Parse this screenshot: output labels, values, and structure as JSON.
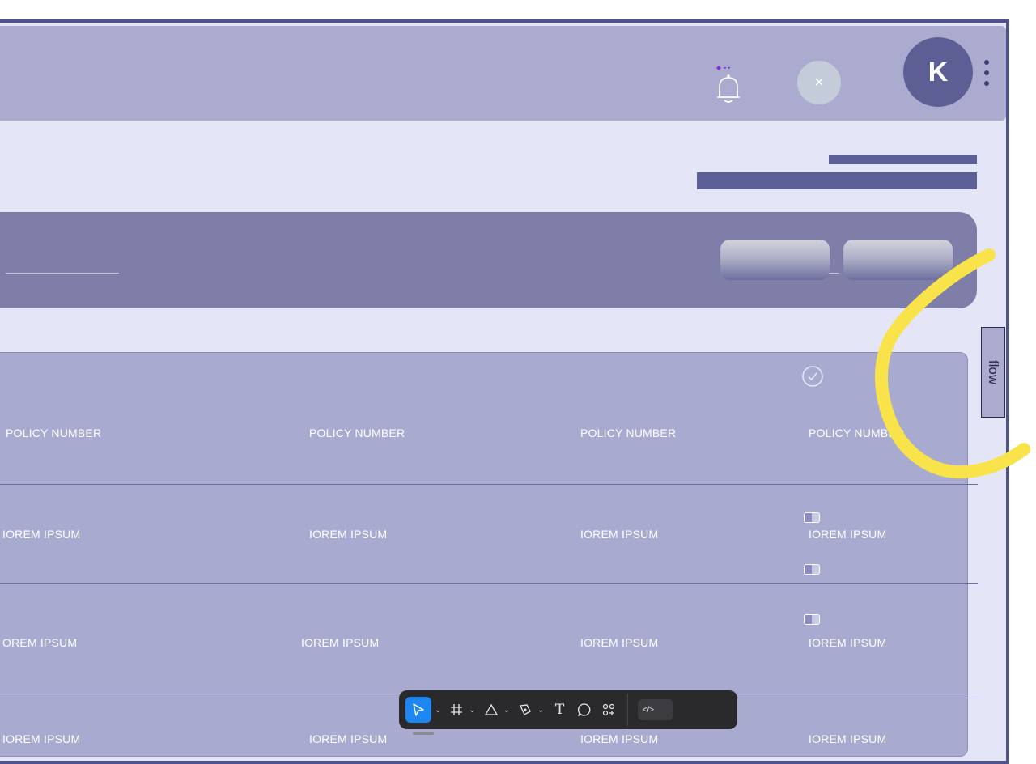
{
  "header": {
    "avatar_letter": "K",
    "close_symbol": "×"
  },
  "table": {
    "header_row": [
      "POLICY NUMBER",
      "POLICY NUMBER",
      "POLICY NUMBER",
      "POLICY NUMBER"
    ],
    "rows": [
      [
        "IOREM IPSUM",
        "IOREM IPSUM",
        "IOREM IPSUM",
        "IOREM IPSUM"
      ],
      [
        "OREM IPSUM",
        "IOREM IPSUM",
        "IOREM IPSUM",
        "IOREM IPSUM"
      ],
      [
        "IOREM IPSUM",
        "IOREM IPSUM",
        "IOREM IPSUM",
        "IOREM IPSUM"
      ]
    ]
  },
  "side_tab": {
    "label": "flow"
  },
  "toolbar": {
    "tools": [
      "move-tool",
      "frame-tool",
      "shape-tool",
      "pen-tool",
      "text-tool",
      "comment-tool",
      "actions-tool",
      "dev-mode-toggle"
    ],
    "text_glyph": "T",
    "frame_glyph": "#",
    "code_glyph": "</>"
  },
  "colors": {
    "header_bg": "#aaabce",
    "page_bg": "#e4e6f8",
    "filter_panel": "#7e7ea9",
    "table_bg": "#a9aad0",
    "avatar": "#5d5f94",
    "accent_active_tool": "#1c86f2",
    "annotation_yellow": "#f8e34a"
  }
}
